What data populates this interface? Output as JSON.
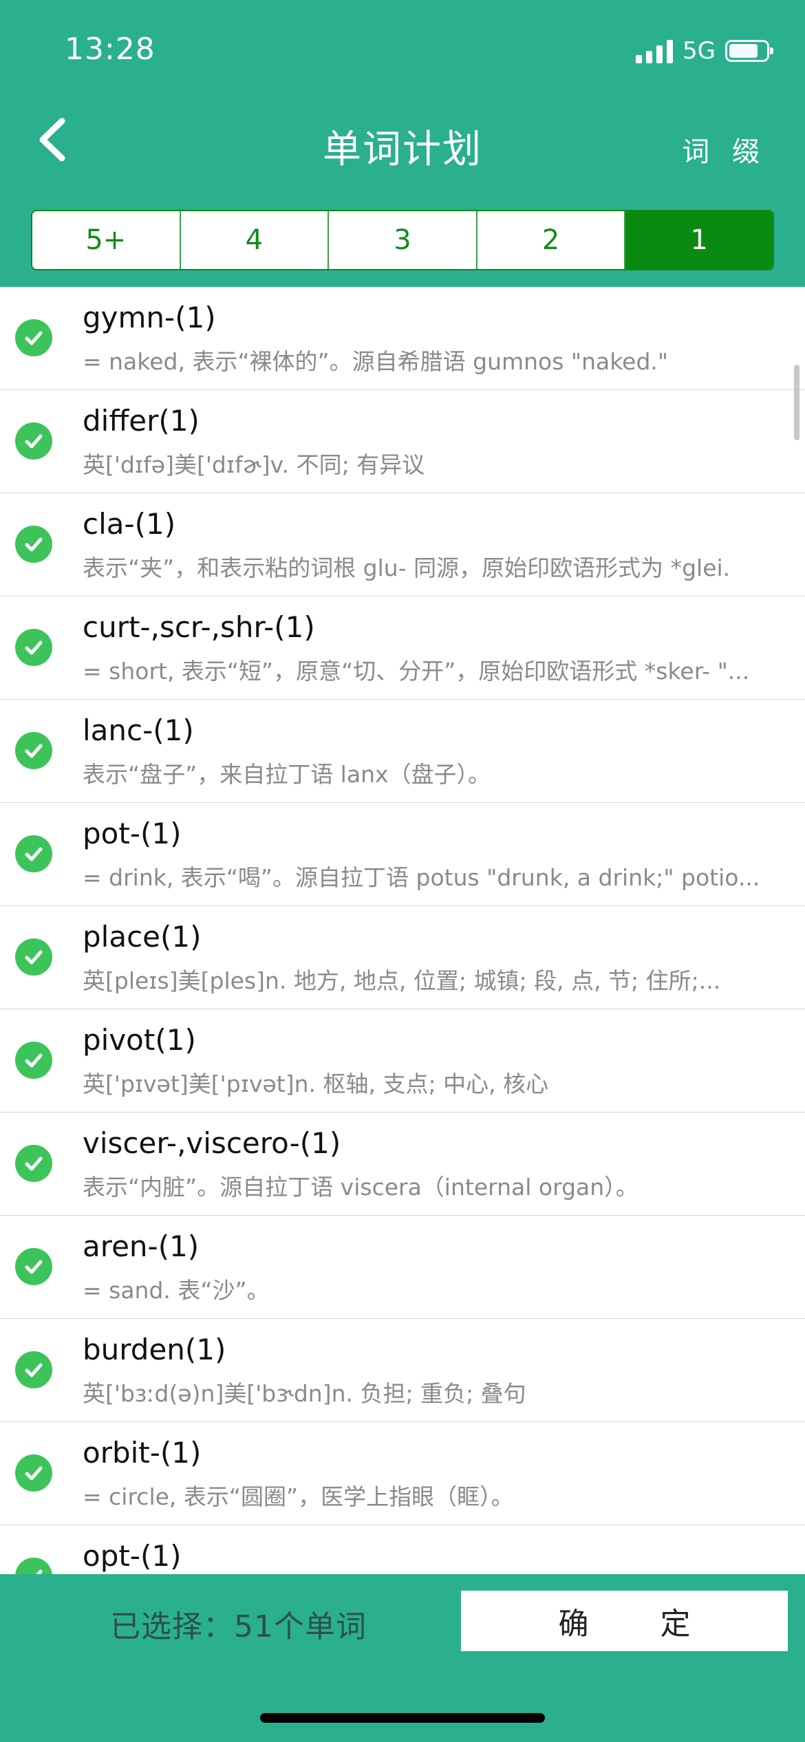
{
  "status_bar": {
    "time": "13:28",
    "network": "5G",
    "battery_level": 0.78
  },
  "header": {
    "title": "单词计划",
    "right_button": "词 缀",
    "back_icon": "chevron-left-icon"
  },
  "tabs": [
    {
      "label": "5+",
      "active": false
    },
    {
      "label": "4",
      "active": false
    },
    {
      "label": "3",
      "active": false
    },
    {
      "label": "2",
      "active": false
    },
    {
      "label": "1",
      "active": true
    }
  ],
  "words": [
    {
      "word": "gymn-(1)",
      "def": "= naked, 表示“裸体的”。源自希腊语 gumnos \"naked.\""
    },
    {
      "word": "differ(1)",
      "def": "英['dɪfə]美['dɪfɚ]v. 不同; 有异议"
    },
    {
      "word": "cla-(1)",
      "def": "表示“夹”，和表示粘的词根 glu- 同源，原始印欧语形式为 *glei."
    },
    {
      "word": "curt-,scr-,shr-(1)",
      "def": "= short, 表示“短”，原意“切、分开”，原始印欧语形式 *sker- \"..."
    },
    {
      "word": "lanc-(1)",
      "def": "表示“盘子”，来自拉丁语 lanx（盘子）。"
    },
    {
      "word": "pot-(1)",
      "def": "= drink, 表示“喝”。源自拉丁语 potus \"drunk, a drink;\" potio..."
    },
    {
      "word": "place(1)",
      "def": "英[pleɪs]美[ples]n. 地方, 地点, 位置; 城镇; 段, 点, 节; 住所;..."
    },
    {
      "word": "pivot(1)",
      "def": "英['pɪvət]美['pɪvət]n. 枢轴, 支点; 中心, 核心"
    },
    {
      "word": "viscer-,viscero-(1)",
      "def": "表示“内脏”。源自拉丁语 viscera（internal organ）。"
    },
    {
      "word": "aren-(1)",
      "def": "= sand. 表“沙”。"
    },
    {
      "word": "burden(1)",
      "def": "英['bɜːd(ə)n]美['bɝdn]n. 负担; 重负; 叠句"
    },
    {
      "word": "orbit-(1)",
      "def": "= circle, 表示“圆圈”，医学上指眼（眶）。"
    },
    {
      "word": "opt-(1)",
      "def": ""
    }
  ],
  "footer": {
    "selected_text": "已选择：51个单词",
    "confirm_label": "确　定"
  },
  "colors": {
    "header_bg": "#2ab08e",
    "tab_active": "#0a8a10",
    "check_green": "#3cc45b"
  }
}
